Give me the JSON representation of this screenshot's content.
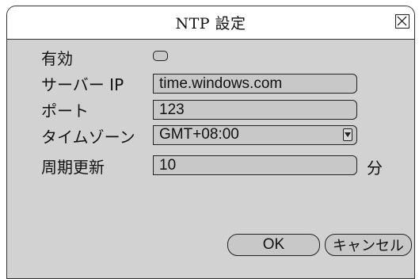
{
  "dialog": {
    "title": "NTP 設定",
    "close_icon": "close-x-icon"
  },
  "form": {
    "enable": {
      "label": "有効",
      "checked": false
    },
    "server": {
      "label_jp": "サーバー",
      "label_ip": "IP",
      "value": "time.windows.com"
    },
    "port": {
      "label": "ポート",
      "value": "123"
    },
    "timezone": {
      "label": "タイムゾーン",
      "value": "GMT+08:00",
      "arrow_icon": "dropdown-arrow-icon"
    },
    "update_period": {
      "label": "周期更新",
      "value": "10",
      "unit": "分"
    }
  },
  "buttons": {
    "ok_label": "OK",
    "cancel_label": "キャンセル"
  },
  "colors": {
    "panel_bg": "#d2d2d2",
    "field_bg": "#c8c8c8",
    "titlebar_bg": "#ffffff",
    "border": "#222222"
  }
}
